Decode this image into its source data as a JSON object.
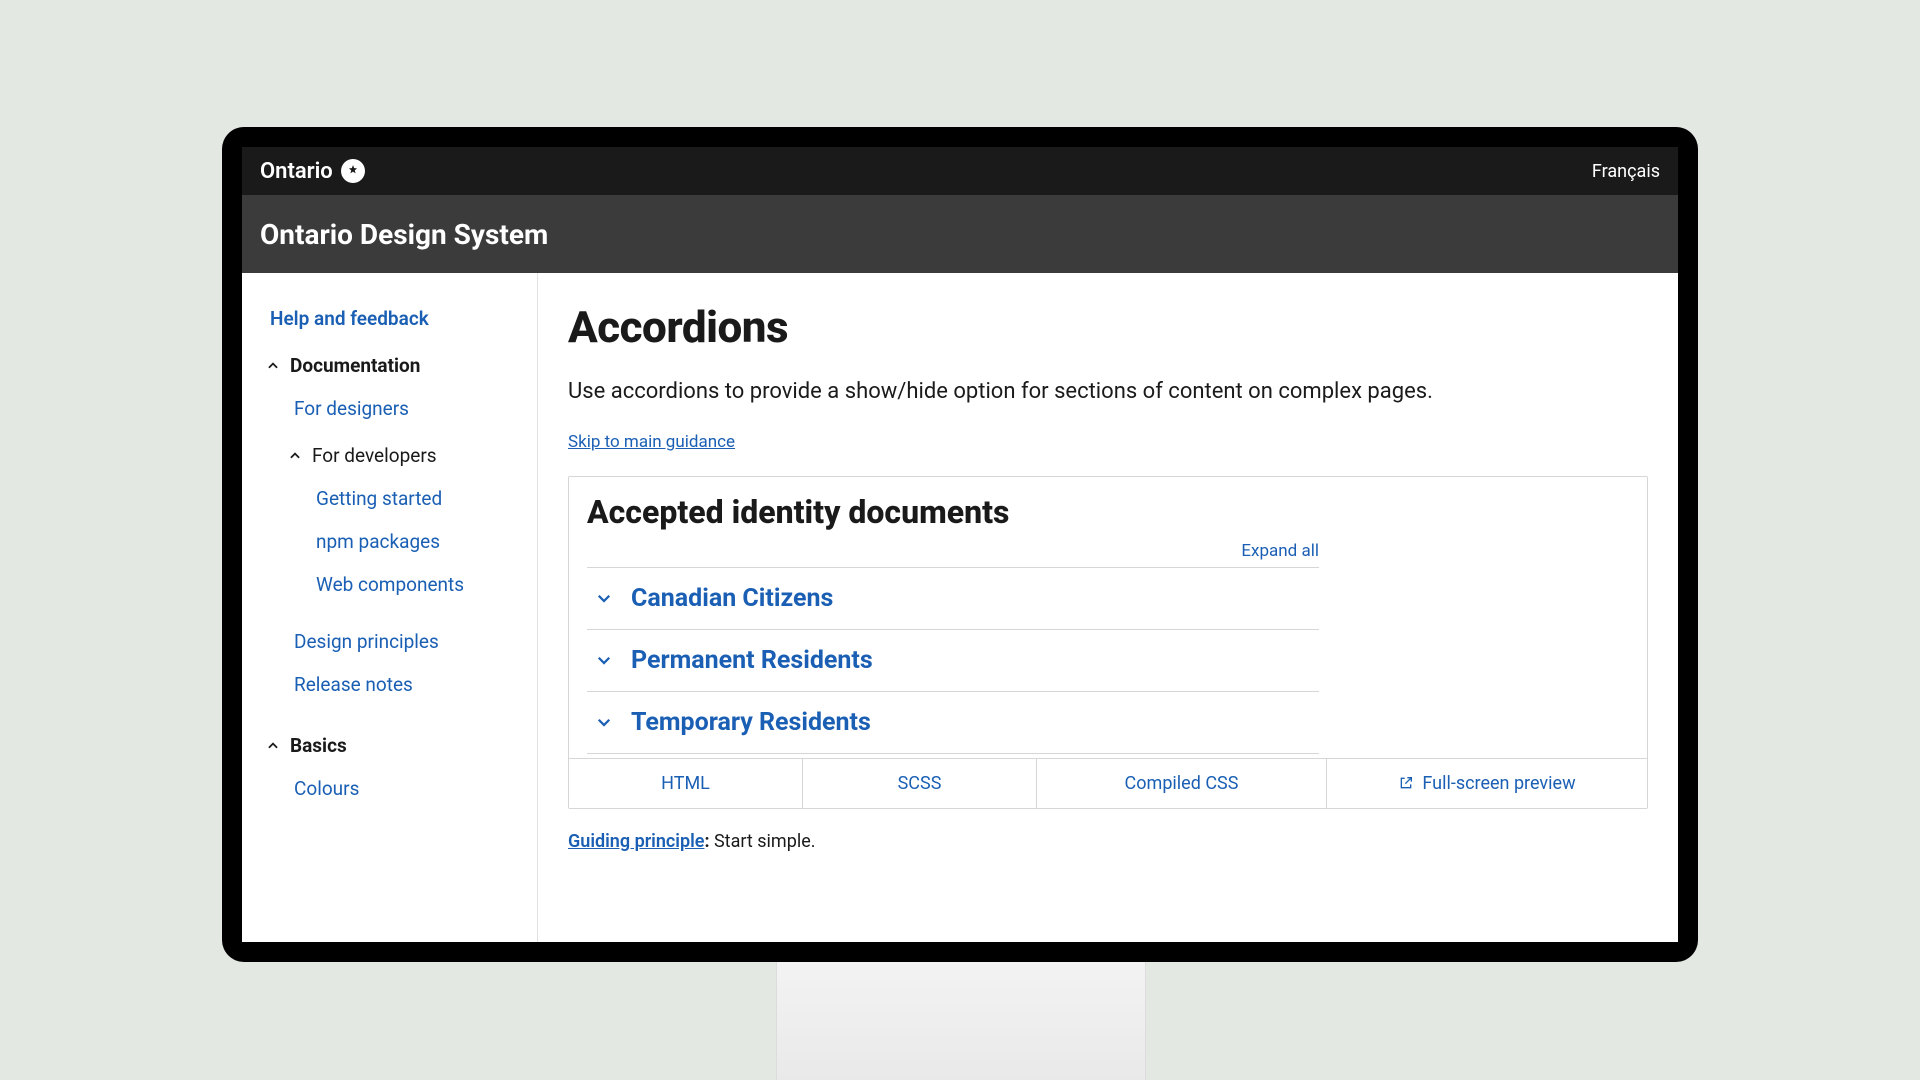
{
  "topbar": {
    "brand": "Ontario",
    "lang": "Français"
  },
  "subheader": {
    "title": "Ontario Design System"
  },
  "sidebar": {
    "help": "Help and feedback",
    "doc_label": "Documentation",
    "designers": "For designers",
    "developers": "For developers",
    "dev_children": {
      "getting_started": "Getting started",
      "npm": "npm packages",
      "webc": "Web components"
    },
    "design_principles": "Design principles",
    "release_notes": "Release notes",
    "basics_label": "Basics",
    "colours": "Colours"
  },
  "main": {
    "title": "Accordions",
    "intro": "Use accordions to provide a show/hide option for sections of content on complex pages.",
    "skip": "Skip to main guidance",
    "example_title": "Accepted identity documents",
    "expand_all": "Expand all",
    "accordion_items": {
      "a": "Canadian Citizens",
      "b": "Permanent Residents",
      "c": "Temporary Residents"
    },
    "tabs": {
      "html": "HTML",
      "scss": "SCSS",
      "compiled": "Compiled CSS",
      "preview": "Full-screen preview"
    },
    "principle_link": "Guiding principle",
    "principle_text": " Start simple."
  }
}
